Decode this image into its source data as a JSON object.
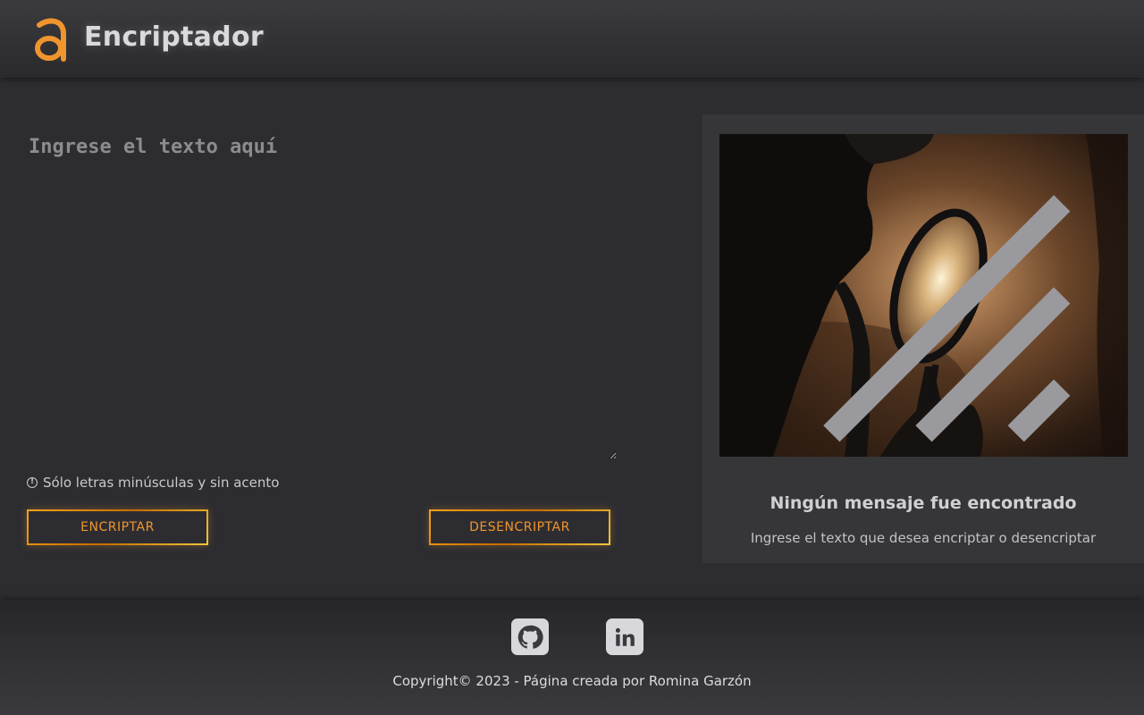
{
  "header": {
    "logo_icon": "letter-a-logo-icon",
    "title": "Encriptador",
    "accent_color": "#f0952d"
  },
  "input": {
    "placeholder": "Ingrese el texto aquí",
    "value": ""
  },
  "hint": {
    "icon": "info-icon",
    "text": "Sólo letras minúsculas y sin acento"
  },
  "buttons": {
    "encrypt_label": "ENCRIPTAR",
    "decrypt_label": "DESENCRIPTAR"
  },
  "output_panel": {
    "image": "detective-magnifying-glass-illustration",
    "title": "Ningún mensaje fue encontrado",
    "subtitle": "Ingrese el texto que desea encriptar o desencriptar"
  },
  "footer": {
    "links": [
      {
        "icon": "github-icon"
      },
      {
        "icon": "linkedin-icon"
      }
    ],
    "copyright": "Copyright© 2023 - Página creada por Romina Garzón"
  }
}
